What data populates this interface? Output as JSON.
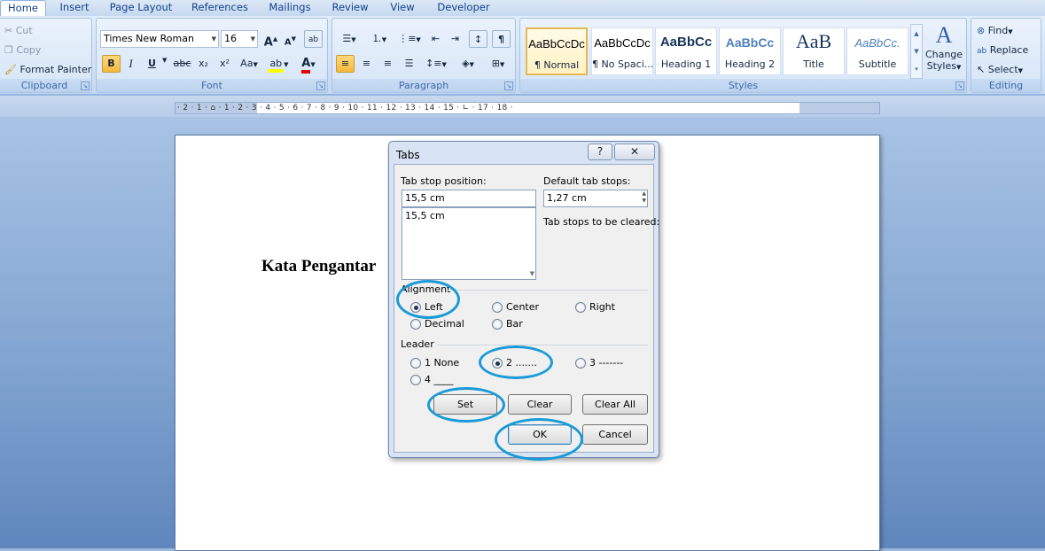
{
  "ribbon_tabs": [
    "Home",
    "Insert",
    "Page Layout",
    "References",
    "Mailings",
    "Review",
    "View",
    "Developer"
  ],
  "clipboard": {
    "cut": "Cut",
    "copy": "Copy",
    "format_painter": "Format Painter",
    "label": "Clipboard"
  },
  "font": {
    "name": "Times New Roman",
    "size": "16",
    "label": "Font",
    "bold": "B",
    "italic": "I",
    "underline": "U",
    "strike": "abc",
    "subscript": "x₂",
    "superscript": "x²",
    "case": "Aa",
    "grow": "A",
    "shrink": "A"
  },
  "paragraph": {
    "label": "Paragraph",
    "pilcrow": "¶"
  },
  "styles": {
    "label": "Styles",
    "items": [
      {
        "sample": "AaBbCcDc",
        "name": "¶ Normal"
      },
      {
        "sample": "AaBbCcDc",
        "name": "¶ No Spaci..."
      },
      {
        "sample": "AaBbCc",
        "name": "Heading 1"
      },
      {
        "sample": "AaBbCc",
        "name": "Heading 2"
      },
      {
        "sample": "AaB",
        "name": "Title"
      },
      {
        "sample": "AaBbCc.",
        "name": "Subtitle"
      }
    ],
    "change_styles_line1": "Change",
    "change_styles_line2": "Styles"
  },
  "editing": {
    "find": "Find",
    "replace": "Replace",
    "select": "Select",
    "label": "Editing"
  },
  "ruler_text": "· 2 · 1 · ⌂ · 1 · 2 · 3 · 4 · 5 · 6 · 7 · 8 · 9 · 10 · 11 · 12 · 13 · 14 · 15 · ∟ · 17 · 18 ·",
  "document": {
    "heading": "Kata Pengantar"
  },
  "dialog": {
    "title": "Tabs",
    "help": "?",
    "close": "✕",
    "tab_stop_position_label": "Tab stop position:",
    "tab_stop_position_value": "15,5 cm",
    "tab_stop_list": [
      "15,5 cm"
    ],
    "default_tab_stops_label": "Default tab stops:",
    "default_tab_stops_value": "1,27 cm",
    "tab_stops_cleared_label": "Tab stops to be cleared:",
    "alignment_label": "Alignment",
    "alignment": [
      {
        "label": "Left",
        "checked": true
      },
      {
        "label": "Center",
        "checked": false
      },
      {
        "label": "Right",
        "checked": false
      },
      {
        "label": "Decimal",
        "checked": false
      },
      {
        "label": "Bar",
        "checked": false
      }
    ],
    "leader_label": "Leader",
    "leader": [
      {
        "label": "1 None",
        "checked": false
      },
      {
        "label": "2 .......",
        "checked": true
      },
      {
        "label": "3 -------",
        "checked": false
      },
      {
        "label": "4 ____",
        "checked": false
      }
    ],
    "set_button": "Set",
    "clear_button": "Clear",
    "clear_all_button": "Clear All",
    "ok_button": "OK",
    "cancel_button": "Cancel"
  },
  "colors": {
    "annotation_circle": "#1a9ad6",
    "ribbon_text": "#15428b"
  }
}
